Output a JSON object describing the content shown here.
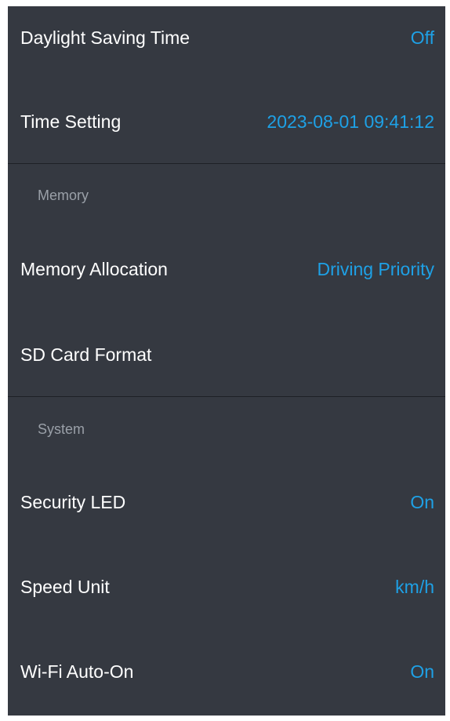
{
  "rows_top": [
    {
      "label": "Daylight Saving Time",
      "value": "Off"
    },
    {
      "label": "Time Setting",
      "value": "2023-08-01 09:41:12"
    }
  ],
  "memory_section": {
    "header": "Memory",
    "rows": [
      {
        "label": "Memory Allocation",
        "value": "Driving Priority"
      },
      {
        "label": "SD Card Format",
        "value": ""
      }
    ]
  },
  "system_section": {
    "header": "System",
    "rows": [
      {
        "label": "Security LED",
        "value": "On"
      },
      {
        "label": "Speed Unit",
        "value": "km/h"
      },
      {
        "label": "Wi-Fi Auto-On",
        "value": "On"
      }
    ]
  },
  "colors": {
    "background": "#353941",
    "label": "#ffffff",
    "value_accent": "#1ea1e6",
    "section_header": "#9aa0a8",
    "divider": "#1e2126"
  }
}
